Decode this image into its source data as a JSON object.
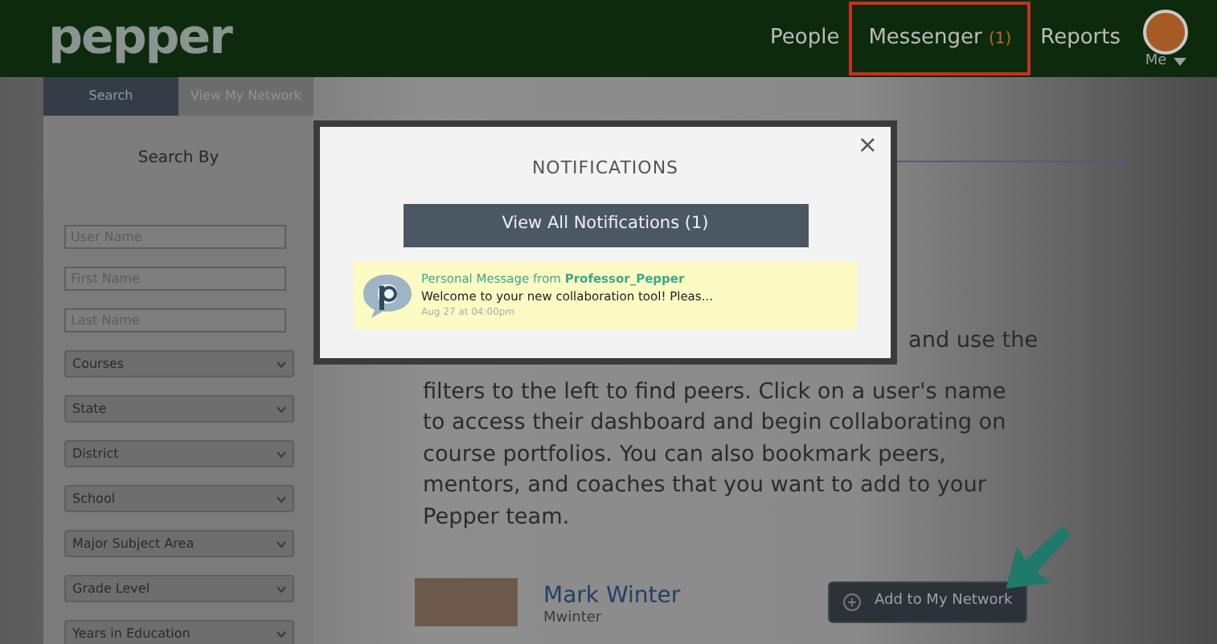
{
  "brand": {
    "logo": "pepper"
  },
  "nav": [
    {
      "label": "People",
      "selected": false
    },
    {
      "label": "Messenger",
      "badge": "(1)",
      "selected": true
    },
    {
      "label": "Reports",
      "selected": false
    }
  ],
  "user_menu": {
    "label": "Me"
  },
  "sidebar": {
    "tabs": [
      {
        "label": "Search",
        "selected": true
      },
      {
        "label": "View My Network",
        "selected": false
      }
    ],
    "heading": "Search By",
    "filters": [
      {
        "kind": "text",
        "placeholder": "User Name"
      },
      {
        "kind": "text",
        "placeholder": "First Name"
      },
      {
        "kind": "text",
        "placeholder": "Last Name"
      },
      {
        "kind": "select",
        "value": "Courses"
      },
      {
        "kind": "select",
        "value": "State"
      },
      {
        "kind": "select",
        "value": "District"
      },
      {
        "kind": "select",
        "value": "School"
      },
      {
        "kind": "select",
        "value": "Major Subject Area"
      },
      {
        "kind": "select",
        "value": "Grade Level"
      },
      {
        "kind": "select",
        "value": "Years in Education"
      }
    ]
  },
  "intro": {
    "visible_start": "and use the",
    "text": "filters to the left to find peers. Click on a user's name to access their dashboard and begin collaborating on course portfolios. You can also bookmark peers, mentors, and coaches that you want to add to your Pepper team."
  },
  "results": [
    {
      "name": "Mark Winter",
      "username": "Mwinter",
      "action": "Add to My Network"
    }
  ],
  "modal": {
    "title": "NOTIFICATIONS",
    "close": "×",
    "button": "View All Notifications (1)",
    "notifications": [
      {
        "heading": "Personal Message from **Professor_Pepper**",
        "message": "Welcome to your new collaboration tool!  Pleas...",
        "time": "Aug 27 at 04:00pm",
        "unread": true
      }
    ]
  }
}
